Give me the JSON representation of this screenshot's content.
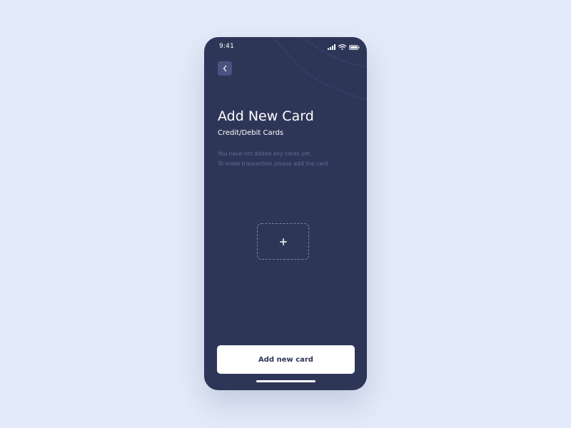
{
  "status_bar": {
    "time": "9:41",
    "icons": [
      "signal-icon",
      "wifi-icon",
      "battery-icon"
    ]
  },
  "header": {
    "back_icon": "chevron-left-icon"
  },
  "content": {
    "title": "Add New Card",
    "subtitle": "Credit/Debit Cards",
    "empty_message": [
      "You have not added any cards yet.",
      "To make transaction please add the card."
    ],
    "add_tile_icon": "plus-icon"
  },
  "footer": {
    "button_label": "Add new card"
  },
  "colors": {
    "page_background": "#e3ebfa",
    "phone_background": "#2e3658",
    "back_button_background": "#4b5480",
    "muted_text": "#626b92",
    "button_background": "#ffffff",
    "button_text": "#2e3658"
  }
}
